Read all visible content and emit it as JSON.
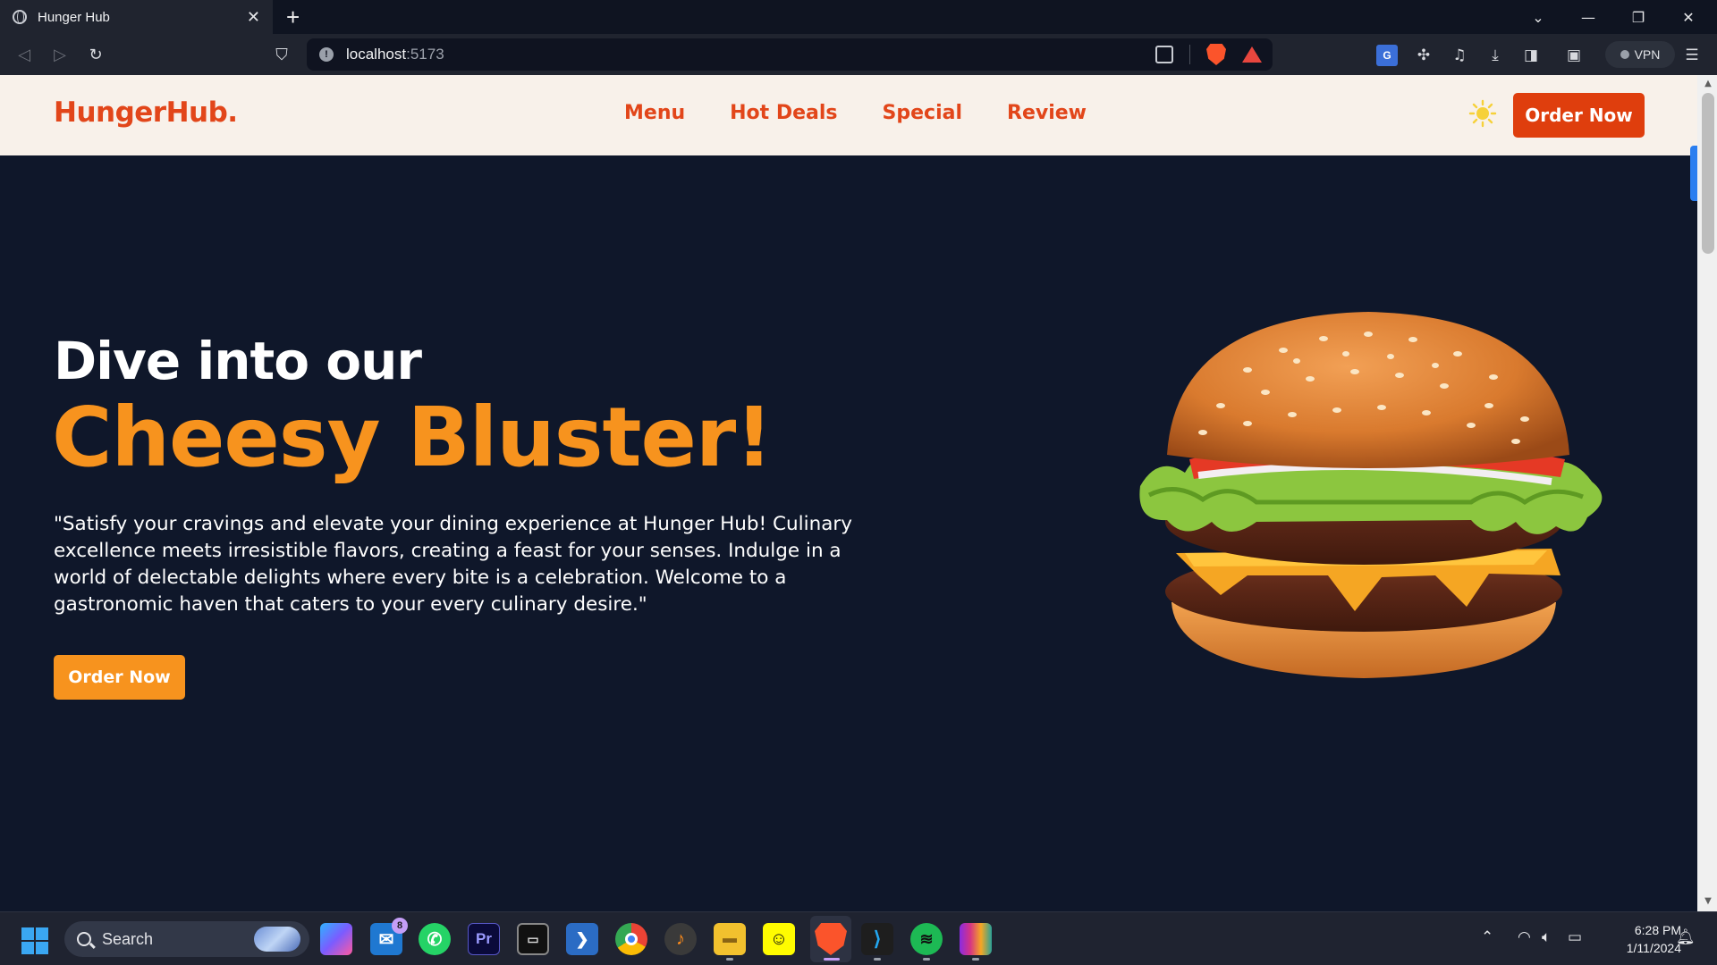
{
  "browser": {
    "tab_title": "Hunger Hub",
    "url_host": "localhost",
    "url_port": ":5173",
    "vpn_label": "VPN"
  },
  "site": {
    "logo": "HungerHub.",
    "nav": [
      "Menu",
      "Hot Deals",
      "Special",
      "Review"
    ],
    "header_cta": "Order Now"
  },
  "hero": {
    "line1": "Dive into our",
    "line2": "Cheesy Bluster!",
    "paragraph": "\"Satisfy your cravings and elevate your dining experience at Hunger Hub! Culinary excellence meets irresistible flavors, creating a feast for your senses. Indulge in a world of delectable delights where every bite is a celebration. Welcome to a gastronomic haven that caters to your every culinary desire.\"",
    "cta": "Order Now"
  },
  "colors": {
    "brand_red": "#df3e0d",
    "brand_orange": "#f7931e",
    "hero_bg": "#0f172a",
    "header_bg": "#f8f1ea"
  },
  "taskbar": {
    "search_label": "Search",
    "mail_badge": "8",
    "premiere_label": "Pr",
    "time": "6:28 PM",
    "date": "1/11/2024"
  }
}
